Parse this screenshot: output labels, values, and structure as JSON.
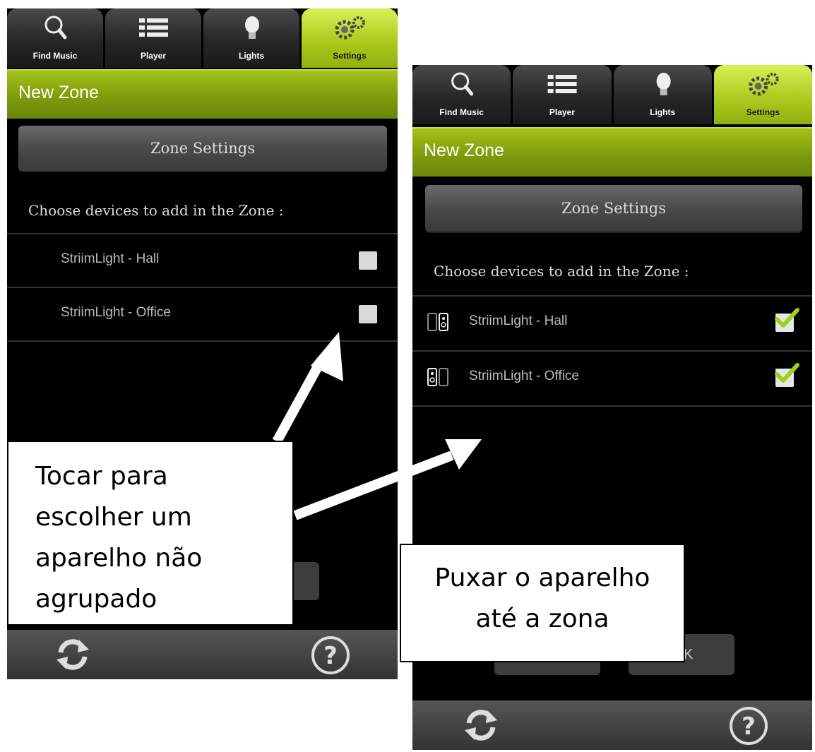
{
  "tabs": [
    {
      "label": "Find Music",
      "icon": "search-icon"
    },
    {
      "label": "Player",
      "icon": "list-icon"
    },
    {
      "label": "Lights",
      "icon": "lightbulb-icon"
    },
    {
      "label": "Settings",
      "icon": "gear-icon"
    }
  ],
  "title": "New Zone",
  "zone_settings_label": "Zone Settings",
  "prompt": "Choose devices to add in the Zone :",
  "devices": [
    {
      "name": "StriimLight - Hall"
    },
    {
      "name": "StriimLight - Office"
    }
  ],
  "screen_left": {
    "devices_checked": [
      false,
      false
    ]
  },
  "screen_right": {
    "devices_checked": [
      true,
      true
    ],
    "partial_button_text": "K"
  },
  "bottom_icons": [
    "refresh-icon",
    "help-icon"
  ],
  "callouts": {
    "left": [
      "Tocar para",
      "escolher um",
      "aparelho não",
      "agrupado"
    ],
    "right": [
      "Puxar o aparelho",
      "até a zona"
    ]
  },
  "colors": {
    "accent": "#a3c21a",
    "check": "#9bd21c"
  }
}
